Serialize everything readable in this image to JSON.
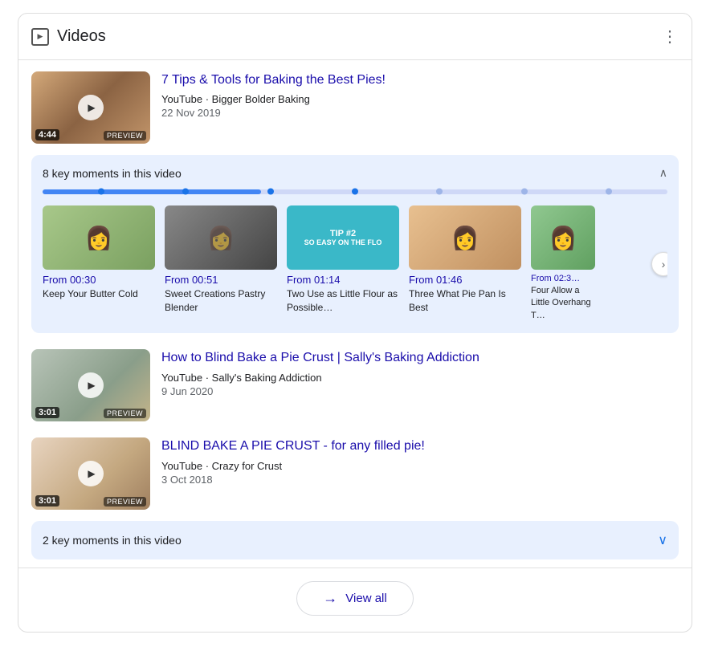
{
  "header": {
    "title": "Videos",
    "menu": "⋮"
  },
  "videos": [
    {
      "id": "v1",
      "title": "7 Tips & Tools for Baking the Best Pies!",
      "source": "YouTube",
      "channel": "Bigger Bolder Baking",
      "date": "22 Nov 2019",
      "duration": "4:44",
      "preview_label": "PREVIEW",
      "thumb_class": "thumb-1"
    },
    {
      "id": "v2",
      "title": "How to Blind Bake a Pie Crust | Sally's Baking Addiction",
      "source": "YouTube",
      "channel": "Sally's Baking Addiction",
      "date": "9 Jun 2020",
      "duration": "3:01",
      "preview_label": "PREVIEW",
      "thumb_class": "thumb-2"
    },
    {
      "id": "v3",
      "title": "BLIND BAKE A PIE CRUST - for any filled pie!",
      "source": "YouTube",
      "channel": "Crazy for Crust",
      "date": "3 Oct 2018",
      "duration": "3:01",
      "preview_label": "PREVIEW",
      "thumb_class": "thumb-3"
    }
  ],
  "key_moments_1": {
    "label": "8 key moments in this video",
    "chevron": "∧",
    "clips": [
      {
        "time": "From 00:30",
        "desc": "Keep Your Butter Cold",
        "thumb_class": "clip-thumb-1"
      },
      {
        "time": "From 00:51",
        "desc": "Sweet Creations Pastry Blender",
        "thumb_class": "clip-thumb-2"
      },
      {
        "time": "From 01:14",
        "desc": "Two Use as Little Flour as Possible…",
        "thumb_class": "clip-thumb-3"
      },
      {
        "time": "From 01:46",
        "desc": "Three What Pie Pan Is Best",
        "thumb_class": "clip-thumb-4"
      },
      {
        "time": "From 02:3…",
        "desc": "Four Allow a Little Overhang T…",
        "thumb_class": "clip-thumb-5"
      }
    ]
  },
  "key_moments_3": {
    "label": "2 key moments in this video",
    "chevron": "∨"
  },
  "view_all": {
    "label": "View all",
    "arrow": "→"
  }
}
